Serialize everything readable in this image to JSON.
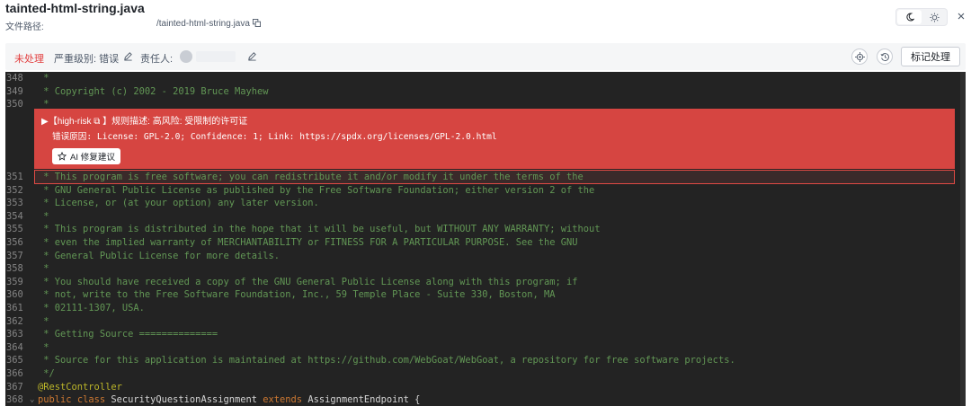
{
  "header": {
    "file_title": "tainted-html-string.java",
    "path_label": "文件路径:",
    "path_value": "/tainted-html-string.java",
    "theme_icons": [
      "moon-icon",
      "sun-icon"
    ],
    "close_icon": "close-icon"
  },
  "toolbar": {
    "status": "未处理",
    "severity": "严重级别: 错误",
    "assignee": "责任人:",
    "mark_button": "标记处理",
    "status_color": "#e23d3d"
  },
  "issue": {
    "head": "▶【high-risk ⧉ 】规则描述: 高风险: 受限制的许可证",
    "reason": "错误原因: License: GPL-2.0; Confidence: 1; Link: https://spdx.org/licenses/GPL-2.0.html",
    "ai_button": "AI 修复建议",
    "bg_color": "#d64541"
  },
  "code_lines": [
    {
      "num": "348",
      "text": " *"
    },
    {
      "num": "349",
      "text": " * Copyright (c) 2002 - 2019 Bruce Mayhew"
    },
    {
      "num": "350",
      "text": " *"
    },
    {
      "num": "351",
      "text": " * This program is free software; you can redistribute it and/or modify it under the terms of the"
    },
    {
      "num": "352",
      "text": " * GNU General Public License as published by the Free Software Foundation; either version 2 of the"
    },
    {
      "num": "353",
      "text": " * License, or (at your option) any later version."
    },
    {
      "num": "354",
      "text": " *"
    },
    {
      "num": "355",
      "text": " * This program is distributed in the hope that it will be useful, but WITHOUT ANY WARRANTY; without"
    },
    {
      "num": "356",
      "text": " * even the implied warranty of MERCHANTABILITY or FITNESS FOR A PARTICULAR PURPOSE. See the GNU"
    },
    {
      "num": "357",
      "text": " * General Public License for more details."
    },
    {
      "num": "358",
      "text": " *"
    },
    {
      "num": "359",
      "text": " * You should have received a copy of the GNU General Public License along with this program; if"
    },
    {
      "num": "360",
      "text": " * not, write to the Free Software Foundation, Inc., 59 Temple Place - Suite 330, Boston, MA"
    },
    {
      "num": "361",
      "text": " * 02111-1307, USA."
    },
    {
      "num": "362",
      "text": " *"
    },
    {
      "num": "363",
      "text": " * Getting Source =============="
    },
    {
      "num": "364",
      "text": " *"
    },
    {
      "num": "365",
      "text": " * Source for this application is maintained at https://github.com/WebGoat/WebGoat, a repository for free software projects."
    },
    {
      "num": "366",
      "text": " */"
    },
    {
      "num": "367",
      "text": "@RestController"
    },
    {
      "num": "368",
      "text": "public class SecurityQuestionAssignment extends AssignmentEndpoint {"
    }
  ]
}
